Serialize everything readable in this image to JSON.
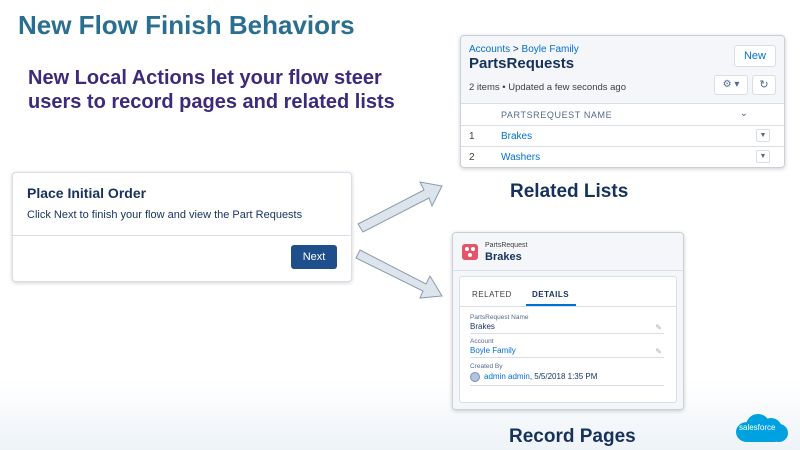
{
  "slide": {
    "title": "New Flow Finish Behaviors",
    "subtitle": "New Local Actions let your flow steer users to record pages and related lists"
  },
  "flow_screen": {
    "title": "Place Initial Order",
    "text": "Click Next to finish your flow and view the Part Requests",
    "next_label": "Next"
  },
  "related_list": {
    "breadcrumb_parent": "Accounts",
    "breadcrumb_sep": " > ",
    "breadcrumb_record": "Boyle Family",
    "title": "PartsRequests",
    "meta": "2 items • Updated a few seconds ago",
    "new_label": "New",
    "gear_label": "⚙ ▾",
    "refresh_label": "↻",
    "column_header": "PARTSREQUEST NAME",
    "column_chevron": "⌄",
    "rows": [
      {
        "num": "1",
        "name": "Brakes"
      },
      {
        "num": "2",
        "name": "Washers"
      }
    ],
    "row_menu": "▼",
    "caption": "Related Lists"
  },
  "record_page": {
    "object_label": "PartsRequest",
    "record_name": "Brakes",
    "tab_related": "RELATED",
    "tab_details": "DETAILS",
    "field_name_label": "PartsRequest Name",
    "field_name_value": "Brakes",
    "field_account_label": "Account",
    "field_account_value": "Boyle Family",
    "field_created_label": "Created By",
    "field_created_user": "admin admin",
    "field_created_date": ", 5/5/2018 1:35 PM",
    "edit_icon": "✎",
    "caption": "Record Pages"
  },
  "logo": {
    "text": "salesforce"
  },
  "colors": {
    "title": "#2a6f8f",
    "subtitle": "#3d2a7a",
    "brand_button": "#1f4e8c",
    "link": "#0070d2",
    "record_icon": "#e3566a",
    "logo_cloud": "#00a1e0"
  }
}
